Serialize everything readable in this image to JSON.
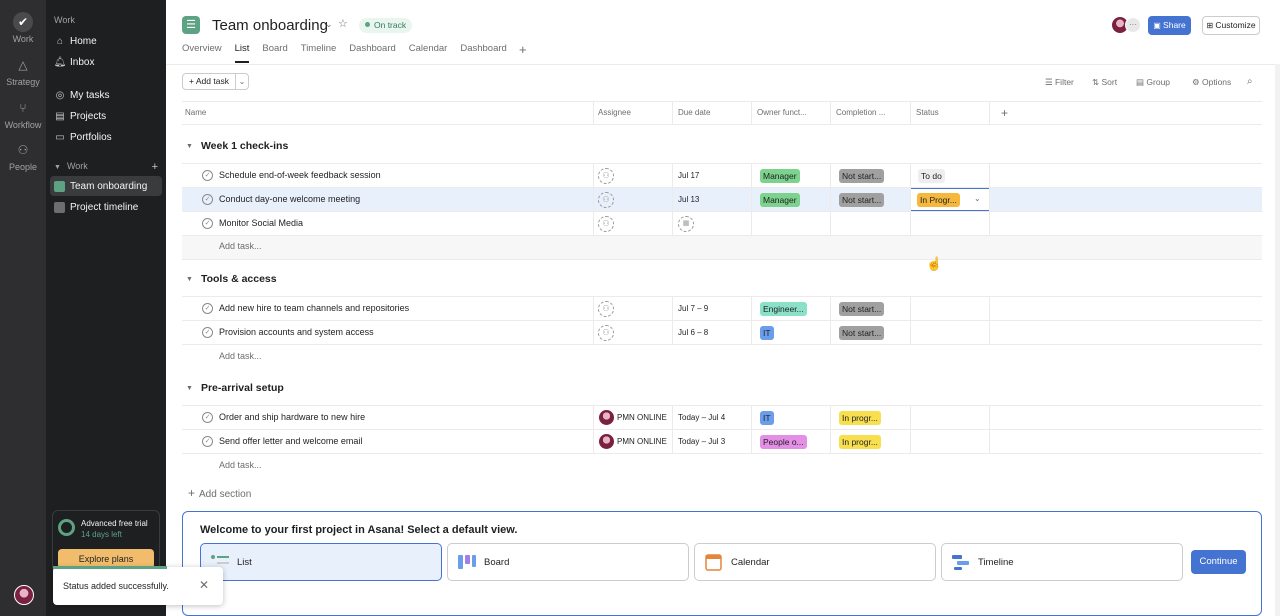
{
  "rail": {
    "items": [
      {
        "label": "Work",
        "icon": "check-circle-icon"
      },
      {
        "label": "Strategy",
        "icon": "triangle-icon"
      },
      {
        "label": "Workflow",
        "icon": "workflow-icon"
      },
      {
        "label": "People",
        "icon": "people-icon"
      }
    ]
  },
  "sidebar": {
    "section_title": "Work",
    "nav": [
      {
        "label": "Home",
        "icon": "home-icon"
      },
      {
        "label": "Inbox",
        "icon": "bell-icon"
      },
      {
        "label": "My tasks",
        "icon": "check-circle-icon"
      },
      {
        "label": "Projects",
        "icon": "clipboard-icon"
      },
      {
        "label": "Portfolios",
        "icon": "folder-icon"
      }
    ],
    "work_group": "Work",
    "projects": [
      {
        "label": "Team onboarding",
        "color": "#5da283"
      },
      {
        "label": "Project timeline",
        "color": "#6d6e6f"
      }
    ],
    "trial": {
      "title": "Advanced free trial",
      "sub": "14 days left",
      "button": "Explore plans"
    }
  },
  "header": {
    "title": "Team onboarding",
    "status": "On track",
    "tabs": [
      "Overview",
      "List",
      "Board",
      "Timeline",
      "Dashboard",
      "Calendar",
      "Dashboard"
    ],
    "active_tab": "List",
    "share": "Share",
    "customize": "Customize"
  },
  "toolbar": {
    "add_task": "Add task",
    "filter": "Filter",
    "sort": "Sort",
    "group": "Group",
    "options": "Options"
  },
  "table": {
    "columns": [
      "Name",
      "Assignee",
      "Due date",
      "Owner funct...",
      "Completion ...",
      "Status"
    ],
    "add_task_label": "Add task...",
    "sections": [
      {
        "name": "Week 1 check-ins",
        "rows": [
          {
            "task": "Schedule end-of-week feedback session",
            "assignee": "",
            "due": "Jul 17",
            "owner": "Manager",
            "completion": "Not start...",
            "status": "To do"
          },
          {
            "task": "Conduct day-one welcome meeting",
            "assignee": "",
            "due": "Jul 13",
            "owner": "Manager",
            "completion": "Not start...",
            "status": "In Progr..."
          },
          {
            "task": "Monitor Social Media",
            "assignee": "",
            "due": "",
            "owner": "",
            "completion": "",
            "status": ""
          }
        ]
      },
      {
        "name": "Tools & access",
        "rows": [
          {
            "task": "Add new hire to team channels and repositories",
            "assignee": "",
            "due": "Jul 7 – 9",
            "owner": "Engineer...",
            "completion": "Not start...",
            "status": ""
          },
          {
            "task": "Provision accounts and system access",
            "assignee": "",
            "due": "Jul 6 – 8",
            "owner": "IT",
            "completion": "Not start...",
            "status": ""
          }
        ]
      },
      {
        "name": "Pre-arrival setup",
        "rows": [
          {
            "task": "Order and ship hardware to new hire",
            "assignee": "PMN ONLINE",
            "due": "Today – Jul 4",
            "owner": "IT",
            "completion": "In progr...",
            "status": ""
          },
          {
            "task": "Send offer letter and welcome email",
            "assignee": "PMN ONLINE",
            "due": "Today – Jul 3",
            "owner": "People o...",
            "completion": "In progr...",
            "status": ""
          }
        ]
      }
    ],
    "add_section": "Add section"
  },
  "tag_colors": {
    "Manager": "#7dd38d",
    "Engineer...": "#8be0c8",
    "IT": "#6b9ded",
    "People o...": "#e38fe6",
    "Not start...": "#a0a0a0",
    "In progr...": "#f8df4f",
    "In Progr...": "#f5b83d",
    "To do": "#efeeee"
  },
  "welcome": {
    "title": "Welcome to your first project in Asana! Select a default view.",
    "options": [
      "List",
      "Board",
      "Calendar",
      "Timeline"
    ],
    "selected": "List",
    "continue": "Continue"
  },
  "toast": {
    "message": "Status added successfully."
  }
}
